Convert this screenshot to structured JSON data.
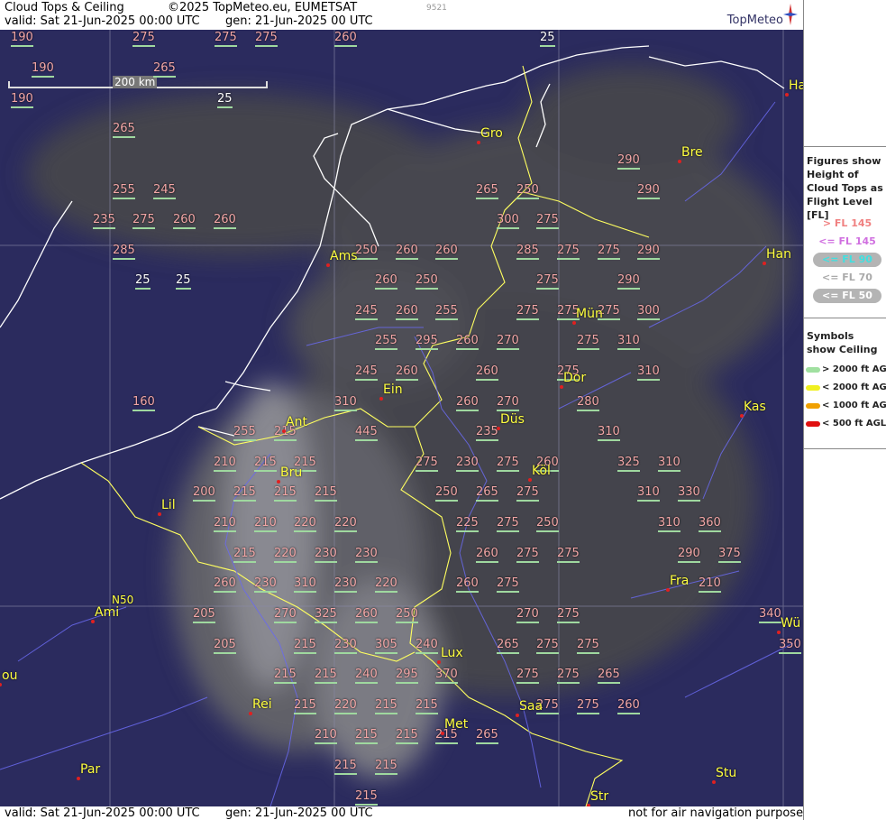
{
  "header": {
    "title": "Cloud Tops & Ceiling",
    "copyright": "©2025 TopMeteo.eu, EUMETSAT",
    "code": "9521",
    "valid": "valid:  Sat  21-Jun-2025  00:00 UTC",
    "gen": "gen: 21-Jun-2025 00 UTC",
    "logo": "TopMeteo"
  },
  "footer": {
    "valid": "valid:  Sat  21-Jun-2025  00:00 UTC",
    "gen": "gen: 21-Jun-2025 00 UTC",
    "note": "not for air navigation purposes"
  },
  "scale_label": "200 km",
  "grid_label": "N50",
  "legend": {
    "title": "Figures show Height of Cloud Tops as Flight Level  [FL]",
    "levels": [
      {
        "label": "> FL 145",
        "color": "#f08080",
        "ellipse": false
      },
      {
        "label": "<= FL 145",
        "color": "#d070e0",
        "ellipse": false
      },
      {
        "label": "<= FL 90",
        "color": "#40e0e0",
        "ellipse": true
      },
      {
        "label": "<= FL 70",
        "color": "#aaaaaa",
        "ellipse": false
      },
      {
        "label": "<= FL 50",
        "color": "#ffffff",
        "ellipse": true
      }
    ],
    "ceiling_title": "Symbols show Ceiling",
    "ceiling": [
      {
        "label": "> 2000 ft AGL",
        "color": "#a0e0a0"
      },
      {
        "label": "< 2000 ft AGL",
        "color": "#f0f020"
      },
      {
        "label": "< 1000 ft AGL",
        "color": "#f0a000"
      },
      {
        "label": "< 500 ft AGL",
        "color": "#e01010"
      }
    ]
  },
  "cities": [
    {
      "name": "Gro"
    },
    {
      "name": "Bre"
    },
    {
      "name": "Ha"
    },
    {
      "name": "Han"
    },
    {
      "name": "Ams"
    },
    {
      "name": "Mün"
    },
    {
      "name": "Ein"
    },
    {
      "name": "Dor"
    },
    {
      "name": "Kas"
    },
    {
      "name": "Ant"
    },
    {
      "name": "Düs"
    },
    {
      "name": "Köl"
    },
    {
      "name": "Bru"
    },
    {
      "name": "Lil"
    },
    {
      "name": "Fra"
    },
    {
      "name": "Ami"
    },
    {
      "name": "Wü"
    },
    {
      "name": "Lux"
    },
    {
      "name": "Saa"
    },
    {
      "name": "ou"
    },
    {
      "name": "Rei"
    },
    {
      "name": "Met"
    },
    {
      "name": "Par"
    },
    {
      "name": "Stu"
    },
    {
      "name": "Str"
    }
  ],
  "values": [
    "190",
    "275",
    "275",
    "275",
    "260",
    "25",
    "190",
    "265",
    "190",
    "25",
    "265",
    "290",
    "255",
    "245",
    "265",
    "250",
    "290",
    "235",
    "275",
    "260",
    "260",
    "300",
    "275",
    "285",
    "250",
    "260",
    "260",
    "285",
    "275",
    "275",
    "290",
    "25",
    "25",
    "260",
    "250",
    "275",
    "290",
    "245",
    "260",
    "255",
    "275",
    "275",
    "275",
    "300",
    "255",
    "295",
    "260",
    "270",
    "275",
    "310",
    "245",
    "260",
    "260",
    "275",
    "310",
    "160",
    "310",
    "260",
    "270",
    "280",
    "255",
    "215",
    "445",
    "235",
    "310",
    "210",
    "215",
    "215",
    "275",
    "230",
    "275",
    "260",
    "325",
    "310",
    "200",
    "215",
    "215",
    "215",
    "250",
    "265",
    "275",
    "310",
    "330",
    "210",
    "210",
    "220",
    "220",
    "225",
    "275",
    "250",
    "310",
    "360",
    "215",
    "220",
    "230",
    "230",
    "260",
    "275",
    "275",
    "290",
    "375",
    "260",
    "230",
    "310",
    "230",
    "220",
    "260",
    "275",
    "210",
    "205",
    "270",
    "325",
    "260",
    "250",
    "270",
    "275",
    "340",
    "205",
    "215",
    "230",
    "305",
    "240",
    "265",
    "275",
    "275",
    "350",
    "215",
    "215",
    "240",
    "295",
    "370",
    "275",
    "275",
    "265",
    "215",
    "220",
    "215",
    "215",
    "275",
    "275",
    "260",
    "210",
    "215",
    "215",
    "215",
    "265",
    "215",
    "215",
    "215"
  ]
}
